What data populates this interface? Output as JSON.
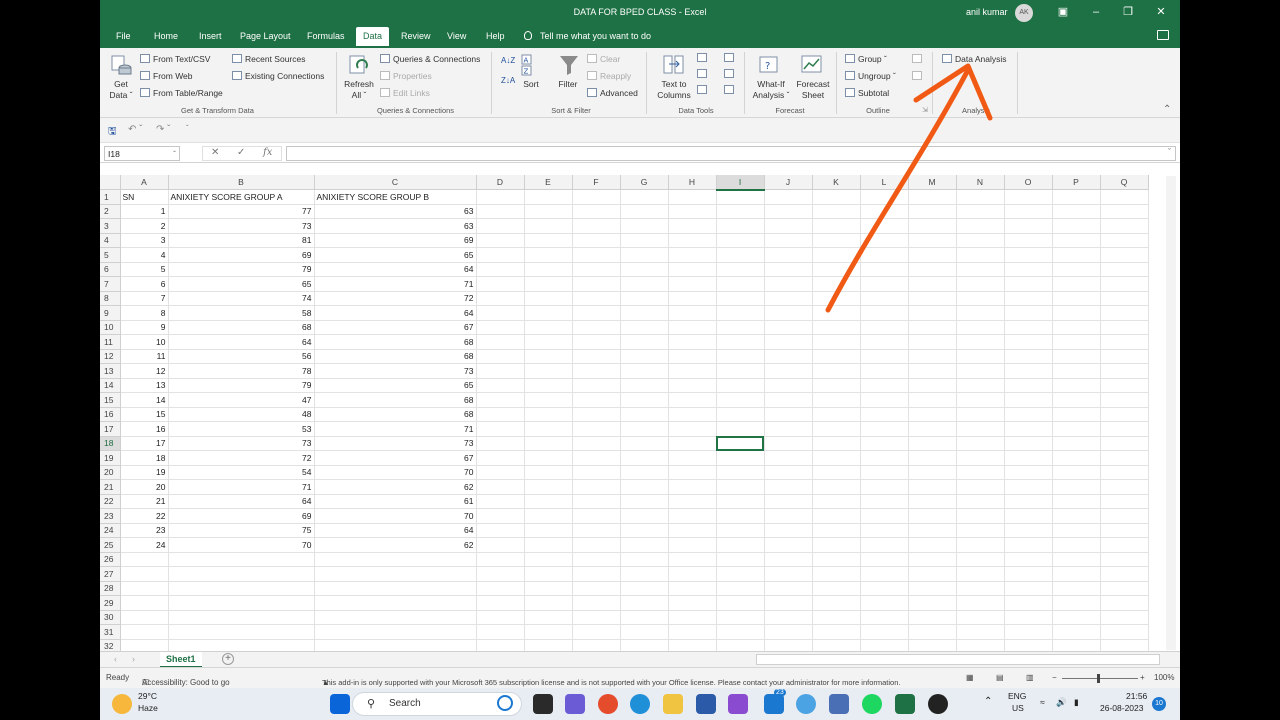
{
  "window": {
    "title": "DATA FOR BPED CLASS  -  Excel",
    "user_name": "anil kumar",
    "user_initials": "AK"
  },
  "menu_tabs": [
    "File",
    "Home",
    "Insert",
    "Page Layout",
    "Formulas",
    "Data",
    "Review",
    "View",
    "Help"
  ],
  "tell_me": "Tell me what you want to do",
  "ribbon": {
    "get_data": "Get Data ˇ",
    "get_data_line1": "Get",
    "get_data_line2": "Data ˇ",
    "from_text_csv": "From Text/CSV",
    "from_web": "From Web",
    "from_table_range": "From Table/Range",
    "recent_sources": "Recent Sources",
    "existing_connections": "Existing Connections",
    "group_get_transform": "Get & Transform Data",
    "refresh_line1": "Refresh",
    "refresh_line2": "All ˇ",
    "queries_connections": "Queries & Connections",
    "properties": "Properties",
    "edit_links": "Edit Links",
    "group_queries": "Queries & Connections",
    "sort": "Sort",
    "filter": "Filter",
    "clear": "Clear",
    "reapply": "Reapply",
    "advanced": "Advanced",
    "group_sort_filter": "Sort & Filter",
    "text_to_columns_line1": "Text to",
    "text_to_columns_line2": "Columns",
    "group_data_tools": "Data Tools",
    "whatif_line1": "What-If",
    "whatif_line2": "Analysis ˇ",
    "forecast_line1": "Forecast",
    "forecast_line2": "Sheet",
    "group_forecast": "Forecast",
    "group_label": "Group",
    "ungroup": "Ungroup",
    "subtotal": "Subtotal",
    "group_outline": "Outline",
    "data_analysis": "Data Analysis",
    "group_analysis": "Analysis"
  },
  "name_box": "I18",
  "formula_fx": "fx",
  "columns": [
    "A",
    "B",
    "C",
    "D",
    "E",
    "F",
    "G",
    "H",
    "I",
    "J",
    "K",
    "L",
    "M",
    "N",
    "O",
    "P",
    "Q"
  ],
  "header_row": {
    "a": "SN",
    "b": "ANIXIETY SCORE GROUP A",
    "c": "ANIXIETY SCORE GROUP B"
  },
  "rows": [
    {
      "sn": "1",
      "a": "77",
      "b": "63"
    },
    {
      "sn": "2",
      "a": "73",
      "b": "63"
    },
    {
      "sn": "3",
      "a": "81",
      "b": "69"
    },
    {
      "sn": "4",
      "a": "69",
      "b": "65"
    },
    {
      "sn": "5",
      "a": "79",
      "b": "64"
    },
    {
      "sn": "6",
      "a": "65",
      "b": "71"
    },
    {
      "sn": "7",
      "a": "74",
      "b": "72"
    },
    {
      "sn": "8",
      "a": "58",
      "b": "64"
    },
    {
      "sn": "9",
      "a": "68",
      "b": "67"
    },
    {
      "sn": "10",
      "a": "64",
      "b": "68"
    },
    {
      "sn": "11",
      "a": "56",
      "b": "68"
    },
    {
      "sn": "12",
      "a": "78",
      "b": "73"
    },
    {
      "sn": "13",
      "a": "79",
      "b": "65"
    },
    {
      "sn": "14",
      "a": "47",
      "b": "68"
    },
    {
      "sn": "15",
      "a": "48",
      "b": "68"
    },
    {
      "sn": "16",
      "a": "53",
      "b": "71"
    },
    {
      "sn": "17",
      "a": "73",
      "b": "73"
    },
    {
      "sn": "18",
      "a": "72",
      "b": "67"
    },
    {
      "sn": "19",
      "a": "54",
      "b": "70"
    },
    {
      "sn": "20",
      "a": "71",
      "b": "62"
    },
    {
      "sn": "21",
      "a": "64",
      "b": "61"
    },
    {
      "sn": "22",
      "a": "69",
      "b": "70"
    },
    {
      "sn": "23",
      "a": "75",
      "b": "64"
    },
    {
      "sn": "24",
      "a": "70",
      "b": "62"
    }
  ],
  "row_numbers": [
    "1",
    "2",
    "3",
    "4",
    "5",
    "6",
    "7",
    "8",
    "9",
    "10",
    "11",
    "12",
    "13",
    "14",
    "15",
    "16",
    "17",
    "18",
    "19",
    "20",
    "21",
    "22",
    "23",
    "24",
    "25",
    "26",
    "27",
    "28",
    "29",
    "30",
    "31",
    "32"
  ],
  "selected_cell": {
    "col": "I",
    "row": "18"
  },
  "sheet_tab": "Sheet1",
  "status": {
    "ready": "Ready",
    "accessibility": "Accessibility: Good to go",
    "addin_message": "This add-in is only supported with your Microsoft 365 subscription license and is not supported with your Office license. Please contact your administrator for more information.",
    "minus": "−",
    "plus": "+",
    "zoom": "100%"
  },
  "taskbar": {
    "weather_temp": "29°C",
    "weather_desc": "Haze",
    "search_placeholder": "Search",
    "chat_badge": "23",
    "lang_line1": "ENG",
    "lang_line2": "US",
    "time": "21:56",
    "date": "26-08-2023",
    "notif_count": "10"
  },
  "colors": {
    "excel_green": "#1e7145",
    "annotation_arrow": "#f15a14"
  }
}
